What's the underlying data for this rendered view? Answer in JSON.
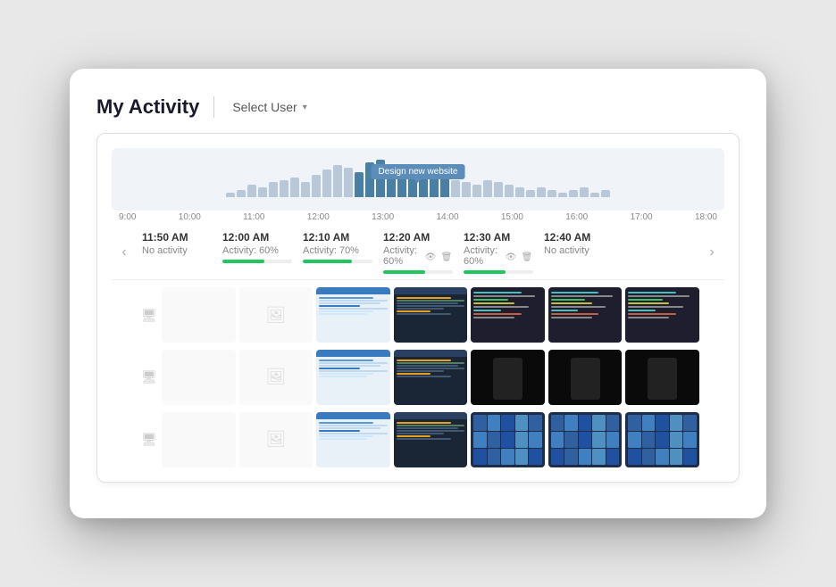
{
  "header": {
    "title": "My Activity",
    "select_user_label": "Select User",
    "select_user_chevron": "▾"
  },
  "chart": {
    "tooltip_label": "Design new website",
    "time_labels": [
      "9:00",
      "10:00",
      "11:00",
      "12:00",
      "13:00",
      "14:00",
      "15:00",
      "16:00",
      "17:00",
      "18:00"
    ],
    "bars": [
      2,
      3,
      5,
      4,
      6,
      7,
      8,
      6,
      9,
      11,
      13,
      12,
      10,
      14,
      15,
      13,
      12,
      11,
      9,
      10,
      8,
      7,
      6,
      5,
      7,
      6,
      5,
      4,
      3,
      4,
      3,
      2,
      3,
      4,
      2,
      3
    ]
  },
  "time_columns": [
    {
      "time": "11:50 AM",
      "activity": "No activity",
      "activity_pct": 0,
      "show_icons": false
    },
    {
      "time": "12:00 AM",
      "activity": "Activity: 60%",
      "activity_pct": 60,
      "show_icons": false
    },
    {
      "time": "12:10 AM",
      "activity": "Activity: 70%",
      "activity_pct": 70,
      "show_icons": false
    },
    {
      "time": "12:20 AM",
      "activity": "Activity: 60%",
      "activity_pct": 60,
      "show_icons": true
    },
    {
      "time": "12:30 AM",
      "activity": "Activity: 60%",
      "activity_pct": 60,
      "show_icons": true
    },
    {
      "time": "12:40 AM",
      "activity": "No activity",
      "activity_pct": 0,
      "show_icons": false
    }
  ],
  "nav": {
    "prev_label": "‹",
    "next_label": "›"
  },
  "rows": [
    {
      "icon": "monitor",
      "type": "screenshots"
    },
    {
      "icon": "monitor",
      "type": "screenshots"
    },
    {
      "icon": "monitor",
      "type": "screenshots"
    }
  ],
  "screenshot_types": {
    "empty": "empty",
    "blue_admin": "blue-admin",
    "dark_code": "dark-code",
    "colorful": "colorful"
  }
}
